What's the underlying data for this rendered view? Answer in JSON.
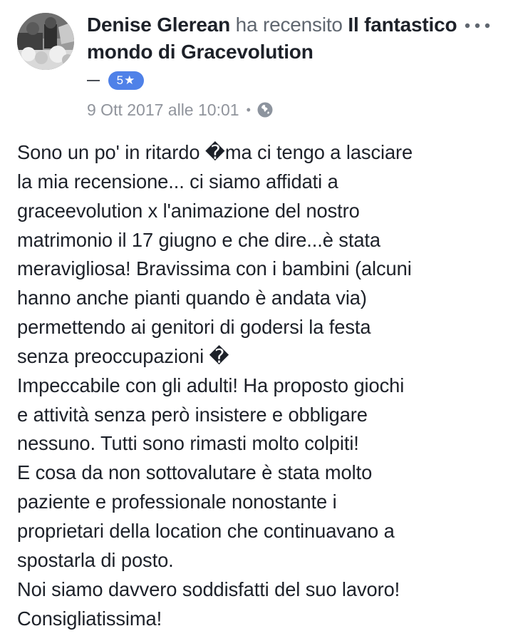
{
  "post": {
    "author": "Denise Glerean",
    "action": "ha recensito",
    "page_name": "Il fantastico mondo di Gracevolution",
    "rating_dash": "—",
    "rating_label": "5★",
    "date": "9 Ott 2017 alle 10:01",
    "separator": "•",
    "privacy_icon": "globe-icon",
    "more_icon": "more-options-icon"
  },
  "review": {
    "text": "Sono un po' in ritardo �ma ci tengo a lasciare\nla mia recensione... ci siamo affidati a\ngraceevolution x l'animazione del nostro\nmatrimonio il 17 giugno e che dire...è stata\nmeravigliosa! Bravissima con i bambini (alcuni\nhanno anche pianti quando è andata via)\npermettendo ai genitori di godersi la festa\nsenza preoccupazioni �\nImpeccabile con gli adulti! Ha proposto giochi\ne attività senza però insistere e obbligare\nnessuno. Tutti sono rimasti molto colpiti!\nE cosa da non sottovalutare è stata molto\npaziente e professionale nonostante i\nproprietari della location che continuavano a\nspostarla di posto.\nNoi siamo davvero soddisfatti del suo lavoro!\nConsigliatissima!"
  },
  "colors": {
    "text_primary": "#1d2129",
    "text_secondary": "#606770",
    "meta_text": "#90949c",
    "rating_badge": "#4f81e8"
  }
}
